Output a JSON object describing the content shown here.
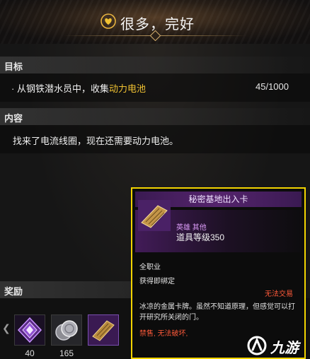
{
  "banner": {
    "title": "很多，完好",
    "icon": "heart-mood-icon",
    "accent": "#f1c232"
  },
  "objective": {
    "header": "目标",
    "bullet": "·",
    "text_before": "从钢铁潜水员中，收集",
    "text_highlight": "动力电池",
    "progress": "45/1000"
  },
  "content": {
    "header": "内容",
    "text": "找来了电流线圈，现在还需要动力电池。"
  },
  "rewards": {
    "header": "奖励",
    "items": [
      {
        "icon": "purple-gem-icon",
        "count": "40"
      },
      {
        "icon": "silver-coins-icon",
        "count": "165"
      },
      {
        "icon": "gold-card-icon",
        "count": ""
      }
    ]
  },
  "tooltip": {
    "title": "秘密基地出入卡",
    "grade": "英雄 其他",
    "item_level": "道具等级350",
    "class": "全职业",
    "bind": "获得即绑定",
    "trade": "无法交易",
    "description": "冰凉的金属卡牌。虽然不知道原理，但感觉可以打开研究所关闭的门。",
    "footer_1": "禁售,",
    "footer_2": "无法破坏,",
    "border_color": "#f2d400"
  },
  "watermark": {
    "text": "九游"
  }
}
